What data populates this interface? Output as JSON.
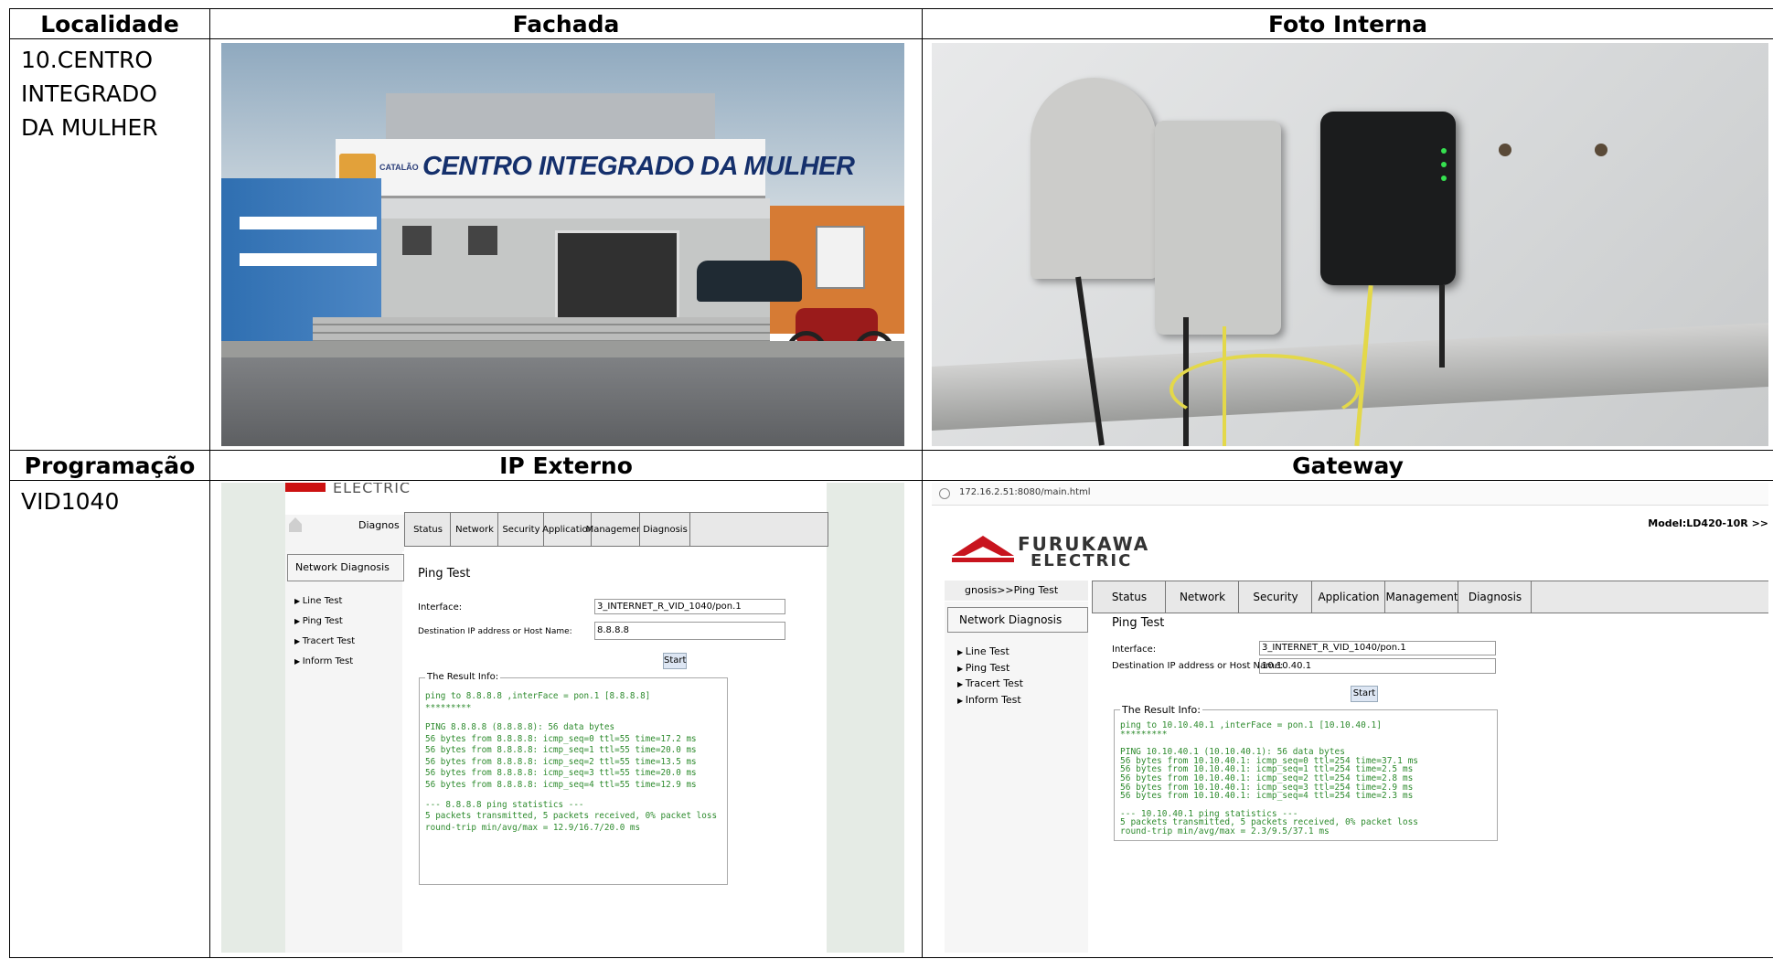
{
  "table": {
    "headers_top": [
      "Localidade",
      "Fachada",
      "Foto Interna"
    ],
    "headers_bottom": [
      "Programação",
      "IP Externo",
      "Gateway"
    ],
    "locality": [
      "10.CENTRO",
      "INTEGRADO",
      "DA MULHER"
    ],
    "programming": "VID1040"
  },
  "fachada": {
    "sign_text": "CENTRO INTEGRADO DA MULHER",
    "logo_text": "CATALÃO"
  },
  "ip_externo": {
    "brand": "ELECTRIC",
    "nav_cut": "Diagnos",
    "tabs": [
      "Status",
      "Network",
      "Security",
      "Application",
      "Management",
      "Diagnosis"
    ],
    "side_header": "Network Diagnosis",
    "side_items": [
      "Line Test",
      "Ping Test",
      "Tracert Test",
      "Inform Test"
    ],
    "title": "Ping Test",
    "interface_label": "Interface:",
    "interface_value": "3_INTERNET_R_VID_1040/pon.1",
    "dest_label": "Destination IP address or Host Name:",
    "dest_value": "8.8.8.8",
    "start": "Start",
    "result_label": "The Result Info:",
    "result_lines": [
      "ping to 8.8.8.8 ,interFace = pon.1 [8.8.8.8]",
      "*********",
      "",
      "PING 8.8.8.8 (8.8.8.8): 56 data bytes",
      "56 bytes from 8.8.8.8: icmp_seq=0 ttl=55 time=17.2 ms",
      "56 bytes from 8.8.8.8: icmp_seq=1 ttl=55 time=20.0 ms",
      "56 bytes from 8.8.8.8: icmp_seq=2 ttl=55 time=13.5 ms",
      "56 bytes from 8.8.8.8: icmp_seq=3 ttl=55 time=20.0 ms",
      "56 bytes from 8.8.8.8: icmp_seq=4 ttl=55 time=12.9 ms",
      "",
      "--- 8.8.8.8 ping statistics ---",
      "5 packets transmitted, 5 packets received, 0% packet loss",
      "round-trip min/avg/max = 12.9/16.7/20.0 ms"
    ]
  },
  "gateway": {
    "url": "172.16.2.51:8080/main.html",
    "model": "Model:LD420-10R >>",
    "brand1": "FURUKAWA",
    "brand2": "ELECTRIC",
    "crumb": "gnosis>>Ping Test",
    "tabs": [
      "Status",
      "Network",
      "Security",
      "Application",
      "Management",
      "Diagnosis"
    ],
    "side_header": "Network Diagnosis",
    "side_items": [
      "Line Test",
      "Ping Test",
      "Tracert Test",
      "Inform Test"
    ],
    "title": "Ping Test",
    "interface_label": "Interface:",
    "interface_value": "3_INTERNET_R_VID_1040/pon.1",
    "dest_label": "Destination IP address or Host Name:",
    "dest_value": "10.10.40.1",
    "start": "Start",
    "result_label": "The Result Info:",
    "result_lines": [
      "ping to 10.10.40.1 ,interFace = pon.1 [10.10.40.1]",
      "*********",
      "",
      "PING 10.10.40.1 (10.10.40.1): 56 data bytes",
      "56 bytes from 10.10.40.1: icmp_seq=0 ttl=254 time=37.1 ms",
      "56 bytes from 10.10.40.1: icmp_seq=1 ttl=254 time=2.5 ms",
      "56 bytes from 10.10.40.1: icmp_seq=2 ttl=254 time=2.8 ms",
      "56 bytes from 10.10.40.1: icmp_seq=3 ttl=254 time=2.9 ms",
      "56 bytes from 10.10.40.1: icmp_seq=4 ttl=254 time=2.3 ms",
      "",
      "--- 10.10.40.1 ping statistics ---",
      "5 packets transmitted, 5 packets received, 0% packet loss",
      "round-trip min/avg/max = 2.3/9.5/37.1 ms"
    ]
  }
}
